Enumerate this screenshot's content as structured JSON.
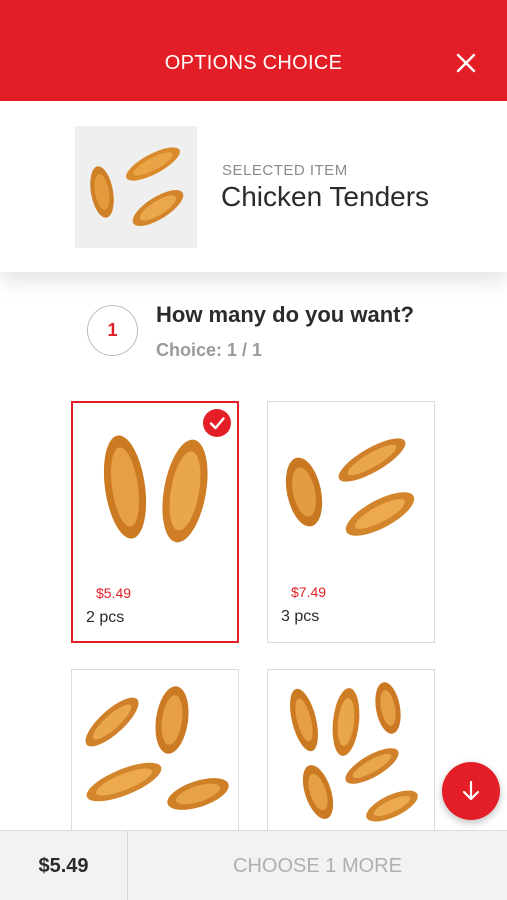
{
  "header": {
    "title": "OPTIONS CHOICE",
    "close_icon": "close-icon",
    "background": "#e41e26"
  },
  "selected_item": {
    "label": "SELECTED ITEM",
    "name": "Chicken Tenders"
  },
  "step": {
    "number": "1",
    "question": "How many do you want?",
    "choice": "Choice: 1 / 1"
  },
  "options": [
    {
      "price": "$5.49",
      "qty": "2 pcs",
      "selected": true
    },
    {
      "price": "$7.49",
      "qty": "3 pcs",
      "selected": false
    },
    {
      "price": "",
      "qty": "",
      "selected": false
    },
    {
      "price": "",
      "qty": "",
      "selected": false
    }
  ],
  "fab": {
    "icon": "arrow-down-icon"
  },
  "footer": {
    "total": "$5.49",
    "action": "CHOOSE 1 MORE"
  },
  "colors": {
    "accent": "#e41e26",
    "muted": "#b0b0b0"
  }
}
